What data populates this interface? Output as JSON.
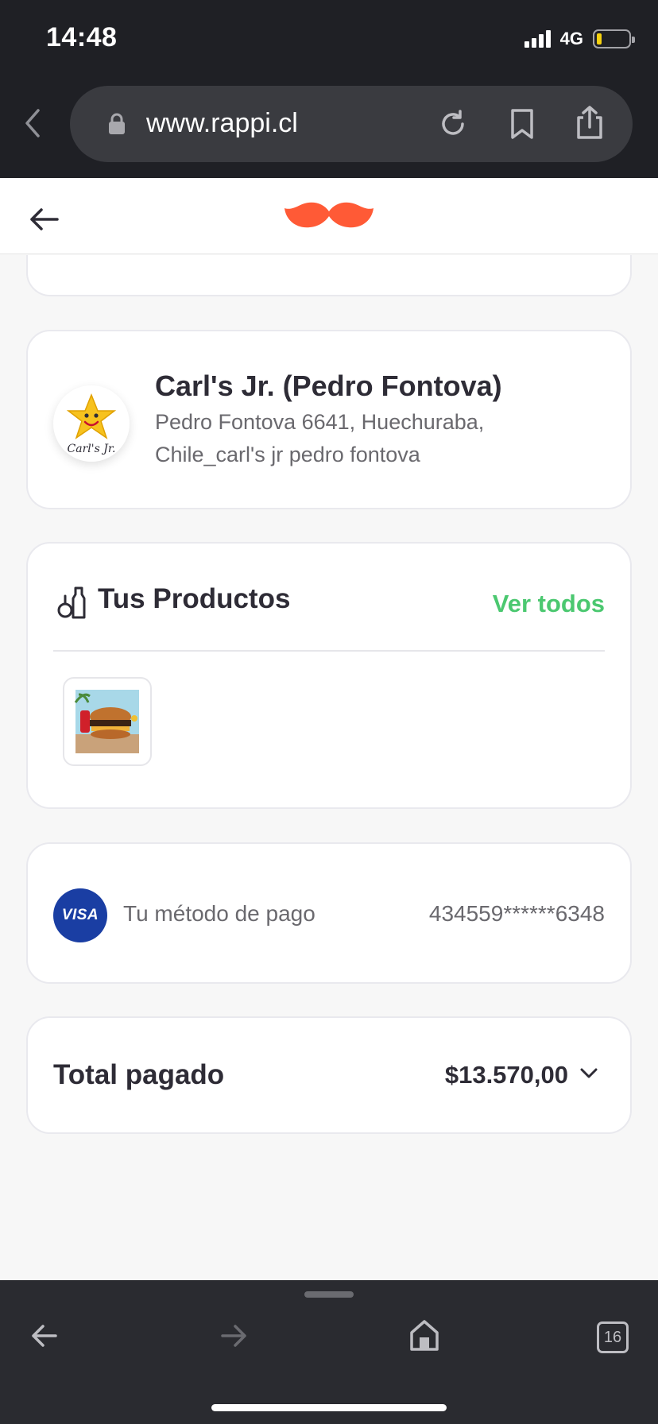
{
  "status_bar": {
    "time": "14:48",
    "network": "4G",
    "battery_level": 0.12,
    "battery_color": "#f6d10f"
  },
  "browser": {
    "url": "www.rappi.cl",
    "icons": [
      "back-icon",
      "lock-icon",
      "reload-icon",
      "bookmark-icon",
      "share-icon"
    ],
    "tabs_count": "16"
  },
  "header": {
    "logo": "rappi-mustache-logo",
    "logo_color": "#ff5a36"
  },
  "store": {
    "name": "Carl's Jr. (Pedro Fontova)",
    "address": "Pedro Fontova 6641, Huechuraba, Chile_carl's jr pedro fontova",
    "logo_text": "Carl's Jr."
  },
  "products": {
    "title": "Tus Productos",
    "see_all": "Ver todos",
    "accent_color": "#4bc870"
  },
  "payment": {
    "brand": "VISA",
    "label": "Tu método de pago",
    "card_number": "434559******6348"
  },
  "total": {
    "label": "Total pagado",
    "amount": "$13.570,00"
  }
}
